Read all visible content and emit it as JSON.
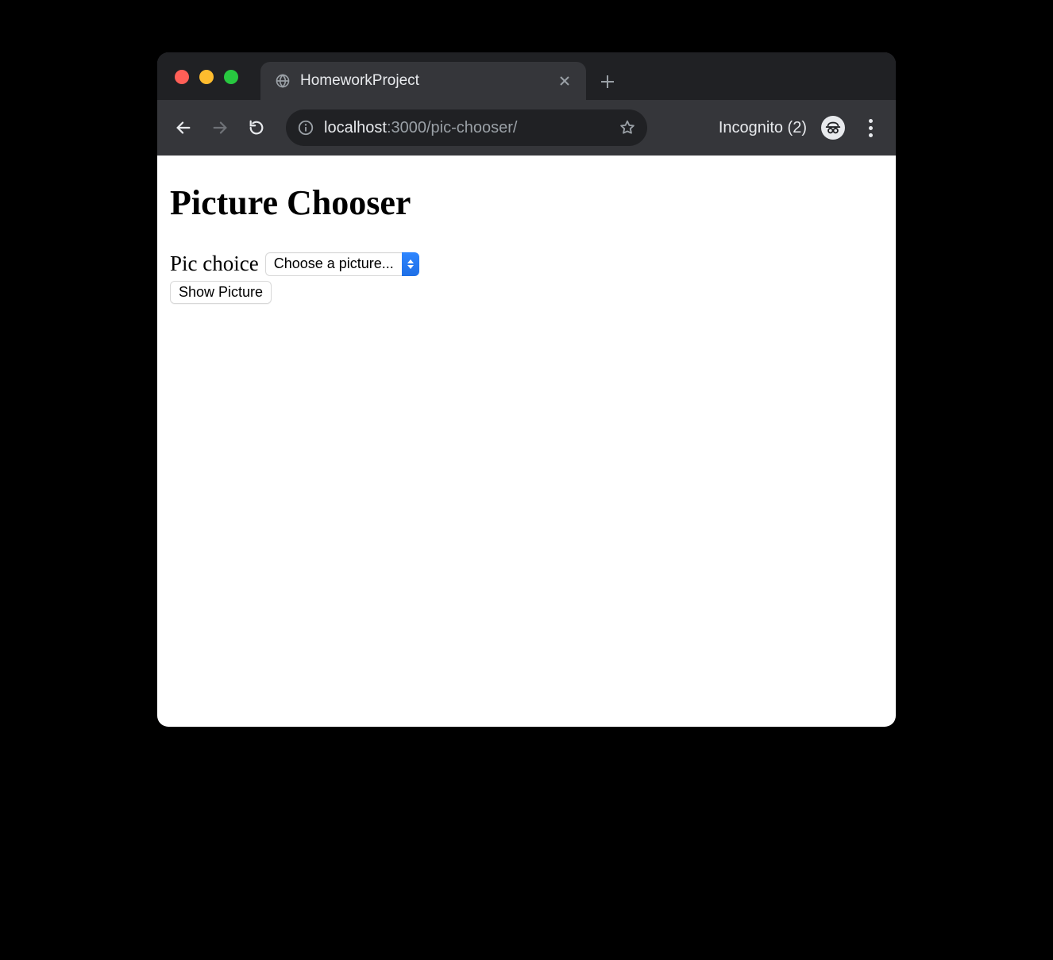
{
  "browser": {
    "tab_title": "HomeworkProject",
    "url_host": "localhost",
    "url_port_path": ":3000/pic-chooser/",
    "incognito_label": "Incognito (2)"
  },
  "page": {
    "heading": "Picture Chooser",
    "label": "Pic choice",
    "select_value": "Choose a picture...",
    "button_label": "Show Picture"
  }
}
